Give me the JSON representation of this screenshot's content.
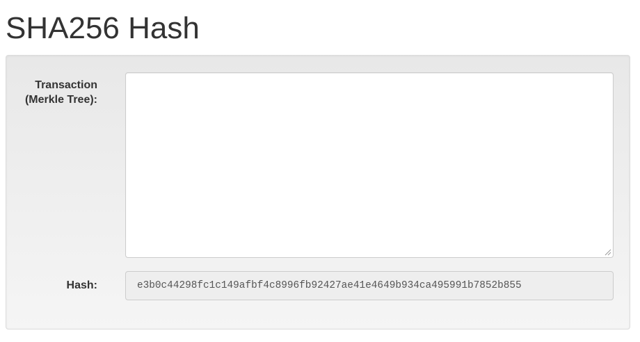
{
  "page": {
    "title": "SHA256 Hash"
  },
  "form": {
    "transaction_label": "Transaction (Merkle Tree):",
    "transaction_value": "",
    "hash_label": "Hash:",
    "hash_value": "e3b0c44298fc1c149afbf4c8996fb92427ae41e4649b934ca495991b7852b855"
  },
  "icons": {
    "resize": "resize-grip-icon"
  },
  "colors": {
    "text": "#333333",
    "well_background": "#f5f5f5",
    "input_readonly_background": "#eeeeee",
    "border": "#cccccc"
  }
}
